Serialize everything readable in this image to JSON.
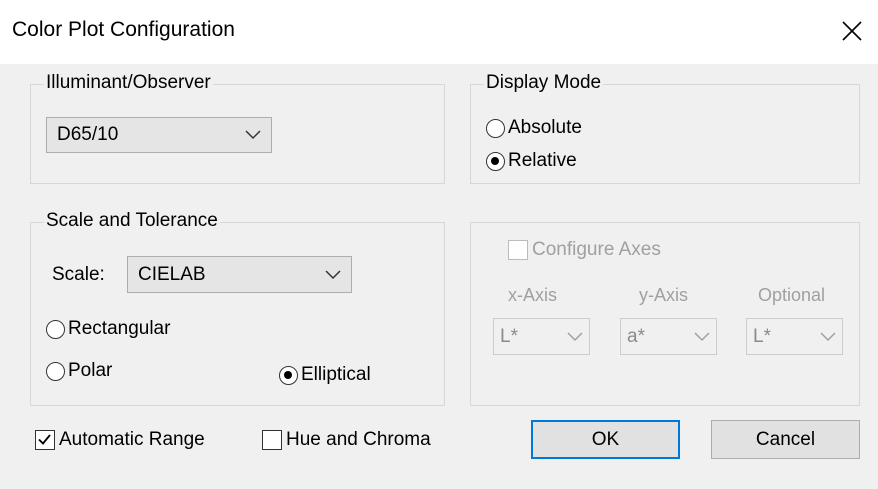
{
  "dialog": {
    "title": "Color Plot Configuration"
  },
  "illuminant": {
    "legend": "Illuminant/Observer",
    "selected": "D65/10"
  },
  "display_mode": {
    "legend": "Display Mode",
    "options": [
      "Absolute",
      "Relative"
    ],
    "selected": "Relative"
  },
  "scale_tolerance": {
    "legend": "Scale and Tolerance",
    "scale_label": "Scale:",
    "scale_selected": "CIELAB",
    "options": [
      "Rectangular",
      "Polar",
      "Elliptical"
    ],
    "selected": "Elliptical"
  },
  "configure_axes": {
    "label": "Configure Axes",
    "checked": false,
    "enabled": false,
    "x_axis": {
      "label": "x-Axis",
      "value": "L*"
    },
    "y_axis": {
      "label": "y-Axis",
      "value": "a*"
    },
    "optional": {
      "label": "Optional",
      "value": "L*"
    }
  },
  "checkboxes": {
    "automatic_range": {
      "label": "Automatic Range",
      "checked": true
    },
    "hue_chroma": {
      "label": "Hue and Chroma",
      "checked": false
    }
  },
  "buttons": {
    "ok": "OK",
    "cancel": "Cancel"
  },
  "colors": {
    "accent": "#0078d7",
    "disabled_text": "#a0a0a0"
  }
}
